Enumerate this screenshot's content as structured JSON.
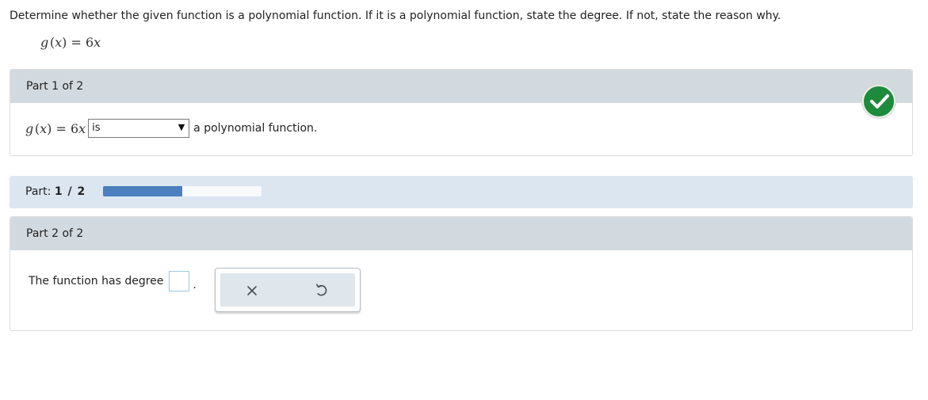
{
  "question": {
    "instruction": "Determine whether the given function is a polynomial function. If it is a polynomial function, state the degree. If not, state the reason why.",
    "function_name": "g",
    "function_arg": "x",
    "function_rhs": "6",
    "function_var": "x"
  },
  "part1": {
    "header": "Part 1 of 2",
    "select_value": "is",
    "after_select_text": "a polynomial function.",
    "status_icon": "checkmark-icon",
    "status_color": "#1e8a3c"
  },
  "progress": {
    "label_prefix": "Part:",
    "current": "1",
    "separator": "/",
    "total": "2",
    "fraction": 0.5,
    "fill_color": "#4b7fbe"
  },
  "part2": {
    "header": "Part 2 of 2",
    "prompt": "The function has degree",
    "degree_value": "",
    "period": ".",
    "tools": [
      "close-icon",
      "undo-icon"
    ]
  }
}
